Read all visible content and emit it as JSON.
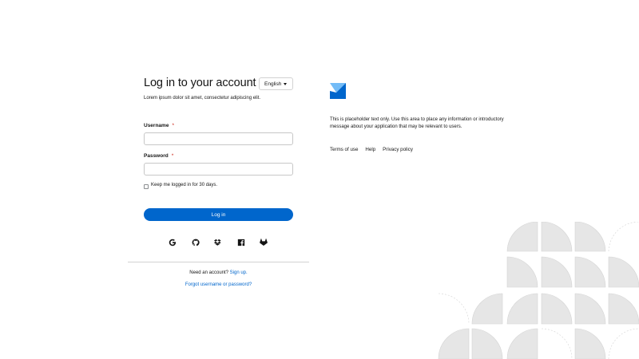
{
  "login": {
    "title": "Log in to your account",
    "subtitle": "Lorem ipsum dolor sit amet, consectetur adipiscing elit.",
    "language": "English",
    "username_label": "Username",
    "password_label": "Password",
    "required_marker": "*",
    "keep_logged_in": "Keep me logged in for 30 days.",
    "login_button": "Log in",
    "social_icons": [
      "google-icon",
      "github-icon",
      "dropbox-icon",
      "facebook-icon",
      "gitlab-icon"
    ],
    "signup_prompt": "Need an account?",
    "signup_link": "Sign up.",
    "forgot_link": "Forgot username or password?"
  },
  "info": {
    "text": "This is placeholder text only. Use this area to place any information or introductory message about your application that may be relevant to users.",
    "footer_links": [
      "Terms of use",
      "Help",
      "Privacy policy"
    ]
  },
  "colors": {
    "primary": "#0066cc",
    "required": "#c9190b",
    "pattern": "#e6e6e6",
    "logo_dark": "#0066cc",
    "logo_light": "#73bcf7"
  }
}
